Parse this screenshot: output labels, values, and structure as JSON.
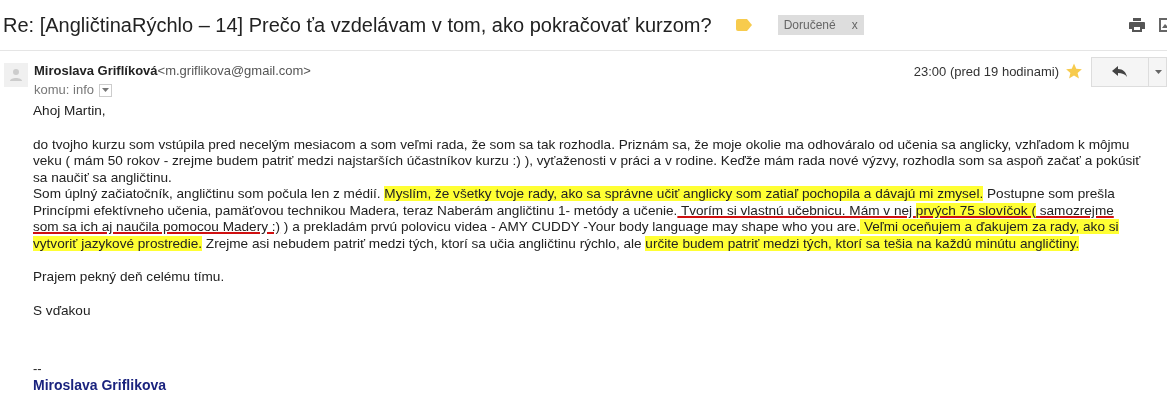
{
  "subject": "Re: [AngličtinaRýchlo – 14] Prečo ťa vzdelávam v tom, ako pokračovať kurzom?",
  "label_chip": {
    "label": "Doručené",
    "close": "x"
  },
  "sender": {
    "name": "Miroslava Griflíková",
    "email": "<m.griflikova@gmail.com>",
    "recipient": "komu: info",
    "time": "23:00 (pred 19 hodinami)",
    "starred": true
  },
  "body": [
    {
      "segments": [
        {
          "text": "Ahoj Martin,",
          "highlight": false,
          "underline": false
        }
      ]
    },
    {
      "segments": [
        {
          "text": "do tvojho  kurzu som vstúpila pred necelým mesiacom a som veľmi rada, že som sa tak rozhodla. Priznám sa, že moje okolie ma odhováralo od učenia sa anglicky, vzhľadom k môjmu veku ( mám 50 rokov - zrejme budem patriť medzi najstarších účastníkov kurzu :) ), vyťaženosti v práci a v rodine. Keďže mám rada nové výzvy, rozhodla som sa aspoň začať a pokúsiť sa naučiť sa angličtinu.",
          "highlight": false,
          "underline": false,
          "break_after": true
        },
        {
          "text": "Som úplný začiatočník, angličtinu som počula len z médií. ",
          "highlight": false,
          "underline": false
        },
        {
          "text": "Myslím, že všetky tvoje rady, ako sa správne učiť anglicky som zatiaľ pochopila a dávajú mi zmysel.",
          "highlight": true,
          "underline": false
        },
        {
          "text": " Postupne som prešla Princípmi efektívneho učenia, pamäťovou technikou Madera,  teraz Naberám angličtinu 1- metódy a učenie.",
          "highlight": false,
          "underline": false
        },
        {
          "text": " Tvorím si vlastnú učebnicu. Mám v nej ",
          "highlight": false,
          "underline": true
        },
        {
          "text": "prvých 75 slovíčok (",
          "highlight": true,
          "underline": true
        },
        {
          "text": " samozrejme som sa ich aj naučila pomocou Madery :)",
          "highlight": false,
          "underline": true
        },
        {
          "text": " ) a prekladám prvú polovicu videa - AMY CUDDY -Your body language may shape who you are.",
          "highlight": false,
          "underline": false
        },
        {
          "text": " Veľmi oceňujem a ďakujem za rady, ako si vytvoriť jazykové prostredie.",
          "highlight": true,
          "underline": false
        },
        {
          "text": " Zrejme asi nebudem patriť medzi tých, ktorí sa učia angličtinu rýchlo, ale ",
          "highlight": false,
          "underline": false
        },
        {
          "text": "určite budem patriť medzi tých, ktorí sa tešia na každú minútu angličtiny.",
          "highlight": true,
          "underline": false
        }
      ]
    },
    {
      "segments": [
        {
          "text": "Prajem pekný deň celému tímu.",
          "highlight": false,
          "underline": false
        }
      ]
    },
    {
      "segments": [
        {
          "text": "S vďakou",
          "highlight": false,
          "underline": false
        }
      ]
    }
  ],
  "signature": {
    "separator": "--",
    "name": "Miroslava Griflikova"
  }
}
